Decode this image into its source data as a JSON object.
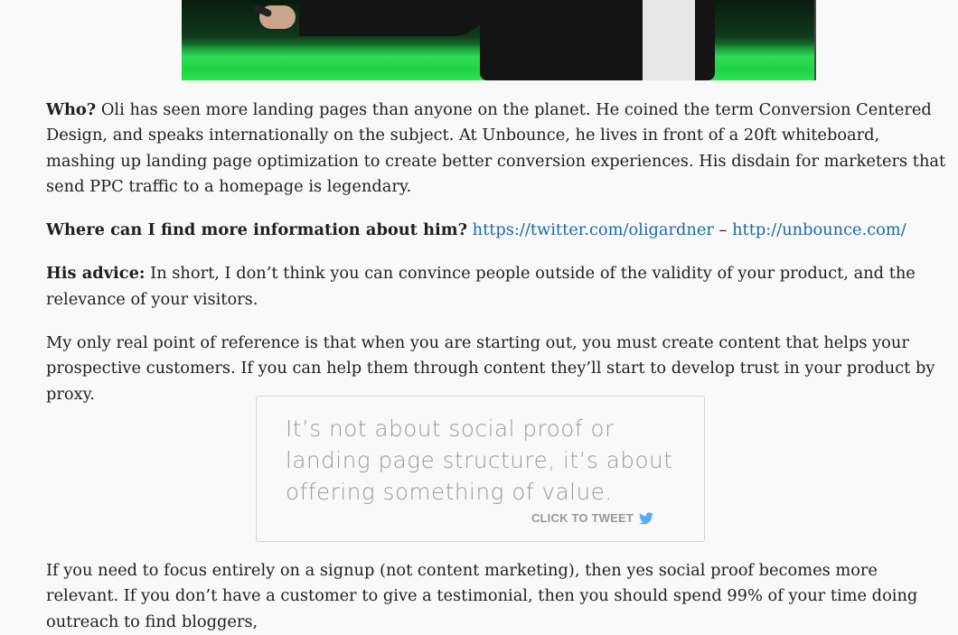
{
  "article": {
    "who_label": "Who?",
    "who_text": " Oli has seen more landing pages than anyone on the planet. He coined the term Conversion Centered Design, and speaks internationally on the subject. At Unbounce, he lives in front of a 20ft whiteboard, mashing up landing page optimization to create better conversion experiences. His disdain for marketers that send PPC traffic to a homepage is legendary.",
    "where_label": "Where can I find more information about him?",
    "link_twitter": "https://twitter.com/oligardner",
    "link_separator": " – ",
    "link_unbounce": "http://unbounce.com/",
    "advice_label": "His advice:",
    "advice_text": "  In short, I don’t think you can convince people outside of the validity of your product, and the relevance of your visitors.",
    "paragraph_reference": "My only real point of reference is that when you are starting out, you must create content that helps your prospective customers. If you can help them through content they’ll start to develop trust in your product by proxy.",
    "paragraph_signup": "If you need to focus entirely on a signup (not content marketing), then yes social proof becomes more relevant. If you don’t have a customer to give a testimonial, then you should spend 99% of your time doing outreach to find bloggers,"
  },
  "click_to_tweet": {
    "quote": "It’s not about social proof or landing page structure, it’s about offering something of value.",
    "label": "CLICK TO TWEET",
    "icon": "twitter-bird-icon"
  },
  "colors": {
    "link": "#1a6aa6",
    "quote_text": "#9a9a9a",
    "twitter_blue": "#55acee",
    "hero_green": "#2de34f"
  }
}
